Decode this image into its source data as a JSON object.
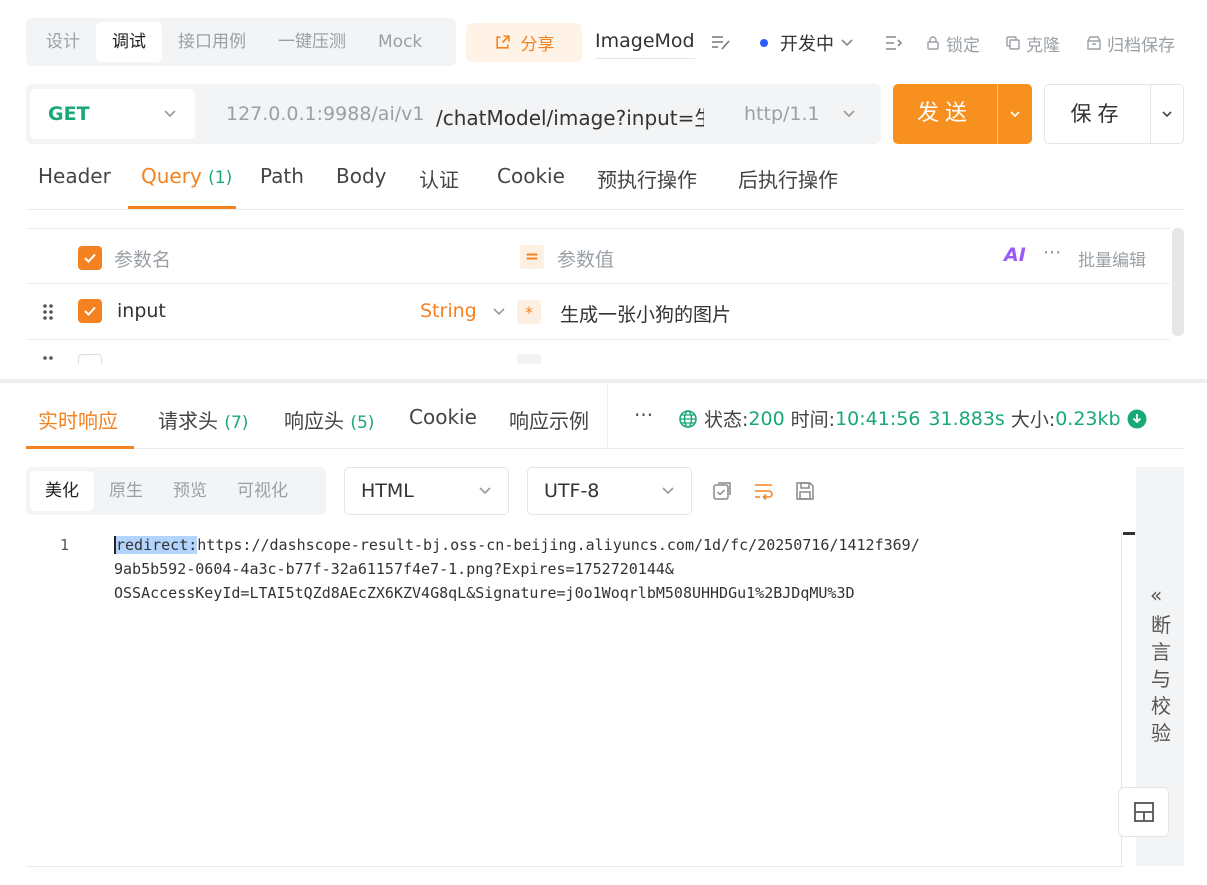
{
  "mode_tabs": [
    "设计",
    "调试",
    "接口用例",
    "一键压测",
    "Mock"
  ],
  "share_label": "分享",
  "doc_name": "ImageMod",
  "env_label": "开发中",
  "top_actions": {
    "lock": "锁定",
    "clone": "克隆",
    "archive": "归档保存"
  },
  "request": {
    "method": "GET",
    "url_base": "127.0.0.1:9988/ai/v1",
    "url_path": "/chatModel/image?input=生",
    "protocol": "http/1.1",
    "send_label": "发送",
    "save_label": "保存"
  },
  "param_tabs": {
    "header": "Header",
    "query": "Query",
    "query_count": "(1)",
    "path": "Path",
    "body": "Body",
    "auth": "认证",
    "cookie": "Cookie",
    "pre": "预执行操作",
    "post": "后执行操作"
  },
  "params_table": {
    "name_placeholder": "参数名",
    "value_placeholder": "参数值",
    "ai_label": "AI",
    "bulk_edit": "批量编辑",
    "rows": [
      {
        "name": "input",
        "type": "String",
        "value": "生成一张小狗的图片"
      }
    ]
  },
  "response_tabs": {
    "realtime": "实时响应",
    "req_headers": "请求头",
    "req_headers_count": "(7)",
    "resp_headers": "响应头",
    "resp_headers_count": "(5)",
    "cookie": "Cookie",
    "example": "响应示例",
    "more": "···"
  },
  "status": {
    "status_label": "状态:",
    "status_code": "200",
    "time_label": "时间:",
    "time": "10:41:56",
    "duration": "31.883s",
    "size_label": "大小:",
    "size": "0.23kb"
  },
  "view_tabs": [
    "美化",
    "原生",
    "预览",
    "可视化"
  ],
  "format_select": "HTML",
  "encoding_select": "UTF-8",
  "code": {
    "line_number": "1",
    "highlight": "redirect:",
    "line1_rest": "https://dashscope-result-bj.oss-cn-beijing.aliyuncs.com/1d/fc/20250716/1412f369/",
    "line2": "9ab5b592-0604-4a3c-b77f-32a61157f4e7-1.png?Expires=1752720144&",
    "line3": "OSSAccessKeyId=LTAI5tQZd8AEcZX6KZV4G8qL&Signature=j0o1WoqrlbM508UHHDGu1%2BJDqMU%3D"
  },
  "side_panel": {
    "chevron": "«",
    "label": [
      "断",
      "言",
      "与",
      "校",
      "验"
    ]
  },
  "colors": {
    "accent": "#f58220",
    "green": "#19a974",
    "blue_dot": "#2e5bff"
  }
}
